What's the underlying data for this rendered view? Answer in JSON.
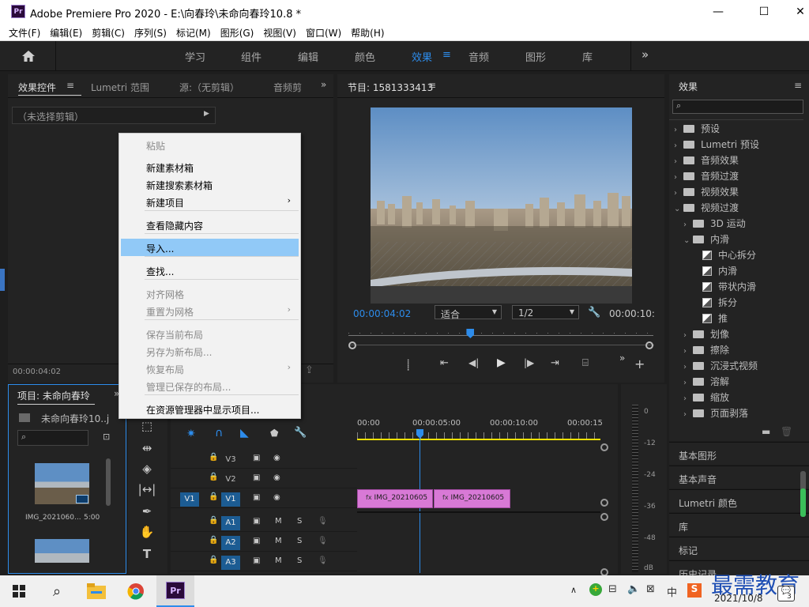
{
  "window": {
    "app_badge": "Pr",
    "title": "Adobe Premiere Pro 2020 - E:\\向春玲\\未命向春玲10.8 *",
    "minimize": "—",
    "maximize": "☐",
    "close": "✕"
  },
  "menubar": [
    "文件(F)",
    "编辑(E)",
    "剪辑(C)",
    "序列(S)",
    "标记(M)",
    "图形(G)",
    "视图(V)",
    "窗口(W)",
    "帮助(H)"
  ],
  "workspaces": {
    "items": [
      "学习",
      "组件",
      "编辑",
      "颜色",
      "效果",
      "音频",
      "图形",
      "库"
    ],
    "active": "效果",
    "more": "»"
  },
  "source_panel": {
    "tabs": [
      "效果控件",
      "Lumetri 范围",
      "源:（无剪辑）",
      "音频剪"
    ],
    "no_clip": "（未选择剪辑）",
    "timecode": "00:00:04:02"
  },
  "context_menu": {
    "items": [
      {
        "label": "粘贴",
        "disabled": true
      },
      {
        "label": "新建素材箱",
        "disabled": false
      },
      {
        "label": "新建搜索素材箱",
        "disabled": false
      },
      {
        "label": "新建项目",
        "disabled": false,
        "submenu": true
      },
      {
        "label": "查看隐藏内容",
        "disabled": false
      },
      {
        "label": "导入...",
        "disabled": false,
        "highlighted": true
      },
      {
        "label": "查找...",
        "disabled": false
      },
      {
        "label": "对齐网格",
        "disabled": true
      },
      {
        "label": "重置为网格",
        "disabled": true,
        "submenu": true
      },
      {
        "label": "保存当前布局",
        "disabled": true
      },
      {
        "label": "另存为新布局...",
        "disabled": true
      },
      {
        "label": "恢复布局",
        "disabled": true,
        "submenu": true
      },
      {
        "label": "管理已保存的布局...",
        "disabled": true
      },
      {
        "label": "在资源管理器中显示项目...",
        "disabled": false
      }
    ]
  },
  "program_monitor": {
    "title": "节目: 1581333413",
    "timecode": "00:00:04:02",
    "fit": "适合",
    "resolution": "1/2",
    "duration": "00:00:10:",
    "playhead_fraction": 0.4
  },
  "project_panel": {
    "title": "项目: 未命向春玲",
    "file": "未命向春玲10..j",
    "clip_name": "IMG_2021060...",
    "clip_duration": "5:00"
  },
  "timeline": {
    "ruler": [
      "00:00",
      "00:00:05:00",
      "00:00:10:00",
      "00:00:15"
    ],
    "video_tracks": [
      "V3",
      "V2",
      "V1"
    ],
    "audio_tracks": [
      "A1",
      "A2",
      "A3"
    ],
    "source_patch": "V1",
    "clips": [
      "IMG_20210605",
      "IMG_20210605"
    ],
    "track_toggles": {
      "mute": "M",
      "solo": "S"
    }
  },
  "meters": [
    "0",
    "-12",
    "-24",
    "-36",
    "-48",
    "dB"
  ],
  "effects_panel": {
    "title": "效果",
    "tree": [
      {
        "label": "预设",
        "level": 0,
        "type": "folder",
        "open": false
      },
      {
        "label": "Lumetri 预设",
        "level": 0,
        "type": "folder",
        "open": false
      },
      {
        "label": "音频效果",
        "level": 0,
        "type": "folder",
        "open": false
      },
      {
        "label": "音频过渡",
        "level": 0,
        "type": "folder",
        "open": false
      },
      {
        "label": "视频效果",
        "level": 0,
        "type": "folder",
        "open": false
      },
      {
        "label": "视频过渡",
        "level": 0,
        "type": "folder",
        "open": true
      },
      {
        "label": "3D 运动",
        "level": 1,
        "type": "folder",
        "open": false
      },
      {
        "label": "内滑",
        "level": 1,
        "type": "folder",
        "open": true
      },
      {
        "label": "中心拆分",
        "level": 2,
        "type": "effect"
      },
      {
        "label": "内滑",
        "level": 2,
        "type": "effect"
      },
      {
        "label": "带状内滑",
        "level": 2,
        "type": "effect"
      },
      {
        "label": "拆分",
        "level": 2,
        "type": "effect"
      },
      {
        "label": "推",
        "level": 2,
        "type": "effect"
      },
      {
        "label": "划像",
        "level": 1,
        "type": "folder",
        "open": false
      },
      {
        "label": "擦除",
        "level": 1,
        "type": "folder",
        "open": false
      },
      {
        "label": "沉浸式视频",
        "level": 1,
        "type": "folder",
        "open": false
      },
      {
        "label": "溶解",
        "level": 1,
        "type": "folder",
        "open": false
      },
      {
        "label": "缩放",
        "level": 1,
        "type": "folder",
        "open": false
      },
      {
        "label": "页面剥落",
        "level": 1,
        "type": "folder",
        "open": false
      }
    ],
    "side_panels": [
      "基本图形",
      "基本声音",
      "Lumetri 颜色",
      "库",
      "标记",
      "历史记录"
    ]
  },
  "taskbar": {
    "time": "2021/10/8",
    "ime": "中",
    "watermark": "最需教育",
    "badge": "3",
    "pr_label": "Pr"
  },
  "colors": {
    "accent": "#2d8ceb",
    "timecode": "#2d8ceb",
    "clip": "#d879d6",
    "track_selected": "#1c5c93",
    "menu_highlight": "#91c9f7"
  }
}
